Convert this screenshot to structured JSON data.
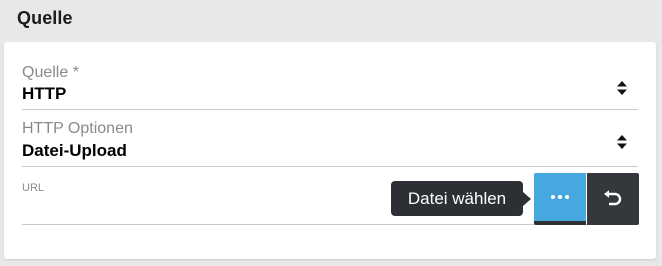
{
  "section": {
    "title": "Quelle"
  },
  "form": {
    "source": {
      "label": "Quelle *",
      "value": "HTTP"
    },
    "http_options": {
      "label": "HTTP Optionen",
      "value": "Datei-Upload"
    },
    "url": {
      "label": "URL",
      "value": ""
    }
  },
  "actions": {
    "tooltip": "Datei wählen",
    "more_icon": "ellipsis-icon",
    "undo_icon": "undo-icon"
  },
  "colors": {
    "accent": "#46a8df",
    "dark": "#34373b",
    "tooltip_bg": "#2c2f34"
  }
}
